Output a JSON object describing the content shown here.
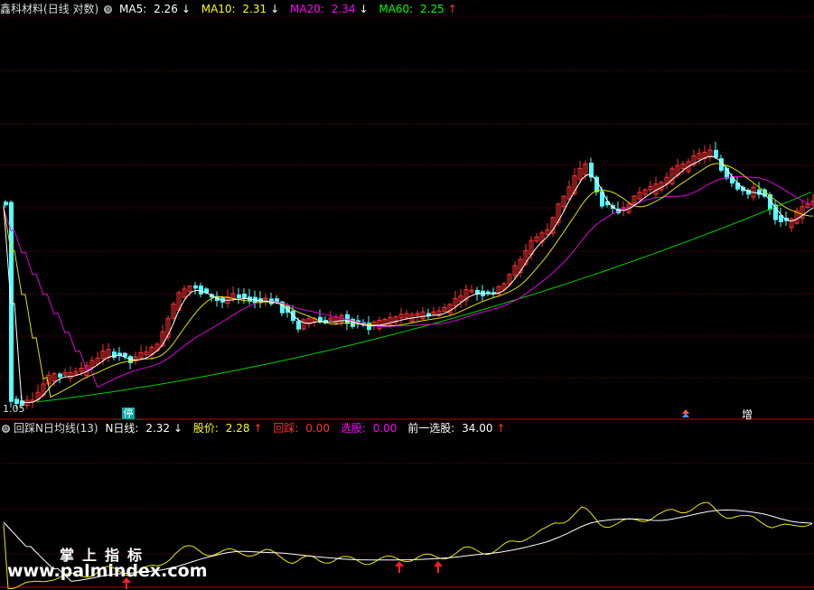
{
  "header": {
    "stock_name": "鑫科材料",
    "period": "(日线 对数)",
    "ma5": {
      "label": "MA5:",
      "value": "2.26",
      "arrow": "↓",
      "color": "#ffffff"
    },
    "ma10": {
      "label": "MA10:",
      "value": "2.31",
      "arrow": "↓",
      "color": "#ffff00"
    },
    "ma20": {
      "label": "MA20:",
      "value": "2.34",
      "arrow": "↓",
      "color": "#ff00ff"
    },
    "ma60": {
      "label": "MA60:",
      "value": "2.25",
      "arrow": "↑",
      "color": "#00ff00"
    }
  },
  "indicator_header": {
    "name": "回踩N日均线(13)",
    "n_line": {
      "label": "N日线:",
      "value": "2.32",
      "arrow": "↓",
      "color": "#ffffff"
    },
    "price": {
      "label": "股价:",
      "value": "2.28",
      "arrow": "↑",
      "color": "#ffff00"
    },
    "pullback": {
      "label": "回踩:",
      "value": "0.00",
      "color": "#ff3333"
    },
    "select": {
      "label": "选股:",
      "value": "0.00",
      "color": "#ff00ff"
    },
    "prev_select": {
      "label": "前一选股:",
      "value": "34.00",
      "arrow": "↑",
      "color": "#ffffff"
    }
  },
  "markers": {
    "date_label": "1.05",
    "suspend_badge": "停",
    "increase_badge": "增"
  },
  "watermark": {
    "line1": "掌上指标",
    "line2": "www.palmindex.com"
  },
  "colors": {
    "up": "#ff3232",
    "down": "#54ffff",
    "grid": "#8b0000",
    "separator": "#c00000"
  }
}
